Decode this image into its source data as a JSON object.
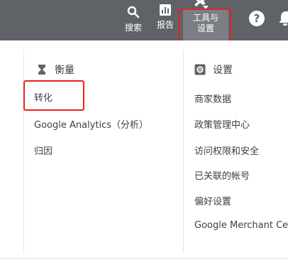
{
  "topbar": {
    "search_label": "搜索",
    "reports_label": "报告",
    "tools_label_line1": "工具与",
    "tools_label_line2": "设置",
    "help_glyph": "?",
    "icons": [
      "search-icon",
      "bar-chart-icon",
      "wrench-icon",
      "help-icon",
      "bell-icon"
    ],
    "background": "#5f6368"
  },
  "measurement": {
    "heading": "衡量",
    "icon": "hourglass-icon",
    "items": [
      {
        "label": "转化"
      },
      {
        "label": "Google Analytics（分析）"
      },
      {
        "label": "归因"
      }
    ]
  },
  "settings": {
    "heading": "设置",
    "icon": "gear-icon",
    "items": [
      {
        "label": "商家数据"
      },
      {
        "label": "政策管理中心"
      },
      {
        "label": "访问权限和安全"
      },
      {
        "label": "已关联的帐号"
      },
      {
        "label": "偏好设置"
      },
      {
        "label": "Google Merchant Cen"
      }
    ]
  },
  "highlight_color": "#e8231f"
}
